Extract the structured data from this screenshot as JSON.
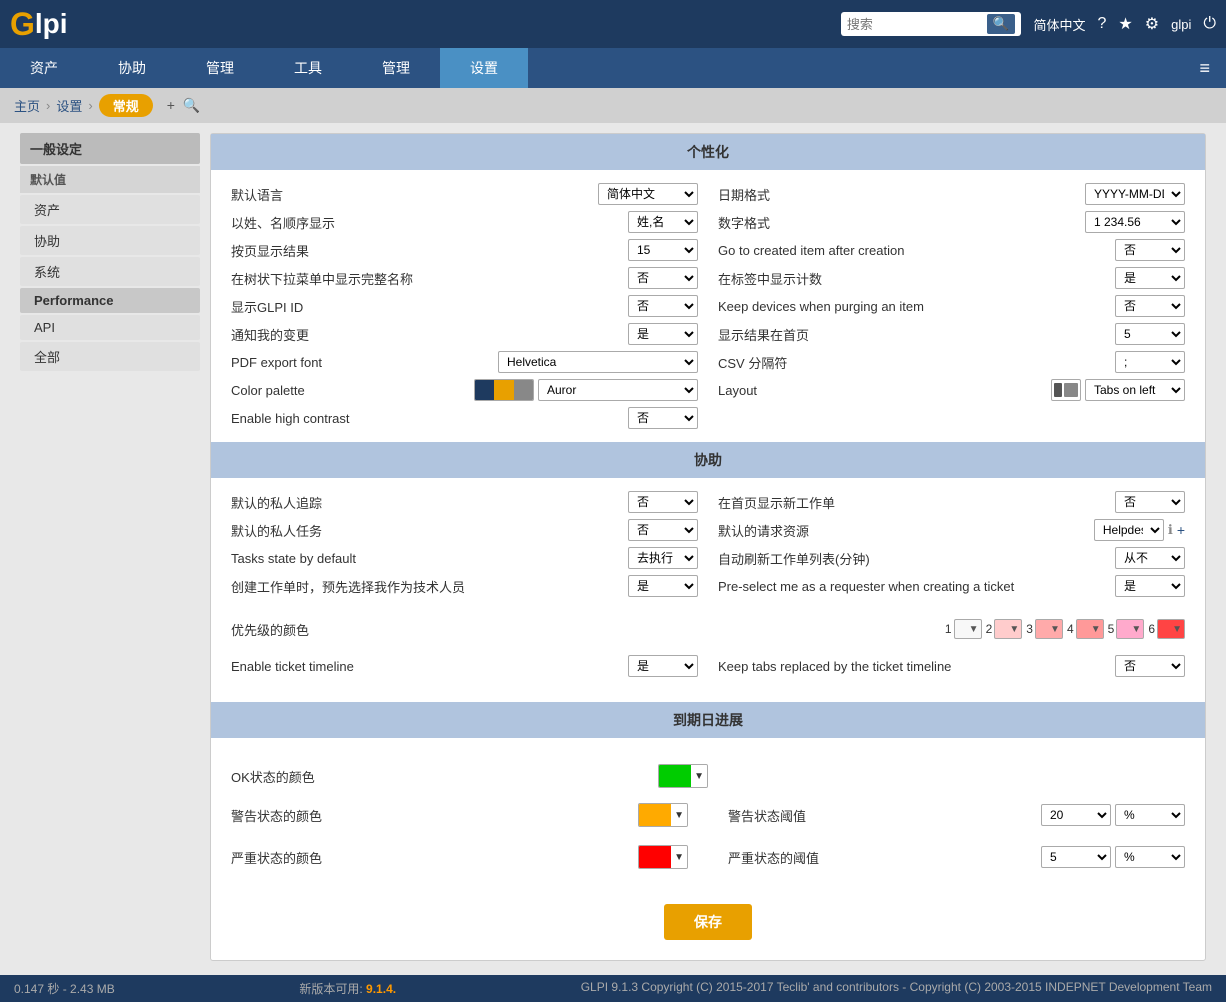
{
  "topbar": {
    "logo_g": "G",
    "logo_rest": "lpi",
    "search_placeholder": "搜索",
    "search_button_label": "🔍",
    "lang_label": "简体中文",
    "help_icon": "?",
    "star_icon": "★",
    "settings_icon": "⚙",
    "user_label": "glpi",
    "power_icon": "⏻"
  },
  "navbar": {
    "items": [
      "资产",
      "协助",
      "管理",
      "工具",
      "管理",
      "设置"
    ]
  },
  "breadcrumb": {
    "home": "主页",
    "settings": "设置",
    "current": "常规",
    "add_icon": "+",
    "search_icon": "🔍"
  },
  "sidebar": {
    "section_title": "一般设定",
    "group_title": "默认值",
    "items": [
      "资产",
      "协助",
      "系统",
      "Performance",
      "API",
      "全部"
    ]
  },
  "personalization": {
    "header": "个性化",
    "fields": {
      "left": [
        {
          "label": "默认语言",
          "value": "简体中文",
          "width": "md"
        },
        {
          "label": "以姓、名顺序显示",
          "value": "姓,名",
          "width": "sm"
        },
        {
          "label": "按页显示结果",
          "value": "15",
          "width": "sm"
        },
        {
          "label": "在树状下拉菜单中显示完整名称",
          "value": "否",
          "width": "sm"
        },
        {
          "label": "显示GLPI ID",
          "value": "否",
          "width": "sm"
        },
        {
          "label": "通知我的变更",
          "value": "是",
          "width": "sm"
        },
        {
          "label": "PDF export font",
          "value": "Helvetica",
          "width": "xl"
        },
        {
          "label": "Color palette",
          "value": "Auror",
          "width": "lg",
          "is_palette": true
        },
        {
          "label": "Enable high contrast",
          "value": "否",
          "width": "sm"
        }
      ],
      "right": [
        {
          "label": "日期格式",
          "value": "YYYY-MM-DD",
          "width": "md"
        },
        {
          "label": "数字格式",
          "value": "1 234.56",
          "width": "md"
        },
        {
          "label": "Go to created item after creation",
          "value": "否",
          "width": "sm"
        },
        {
          "label": "在标签中显示计数",
          "value": "是",
          "width": "sm"
        },
        {
          "label": "Keep devices when purging an item",
          "value": "否",
          "width": "sm"
        },
        {
          "label": "显示结果在首页",
          "value": "5",
          "width": "sm"
        },
        {
          "label": "CSV 分隔符",
          "value": ";",
          "width": "sm"
        },
        {
          "label": "Layout",
          "value": "Tabs on left",
          "width": "lg",
          "is_layout": true
        }
      ]
    }
  },
  "assistance": {
    "header": "协助",
    "fields": {
      "left": [
        {
          "label": "默认的私人追踪",
          "value": "否",
          "width": "sm"
        },
        {
          "label": "默认的私人任务",
          "value": "否",
          "width": "sm"
        },
        {
          "label": "Tasks state by default",
          "value": "去执行",
          "width": "sm"
        },
        {
          "label": "创建工作单时，预先选择我作为技术人员",
          "value": "是",
          "width": "sm"
        }
      ],
      "right": [
        {
          "label": "在首页显示新工作单",
          "value": "否",
          "width": "sm"
        },
        {
          "label": "默认的请求资源",
          "value": "Helpdesk",
          "width": "sm"
        },
        {
          "label": "自动刷新工作单列表(分钟)",
          "value": "从不",
          "width": "sm"
        },
        {
          "label": "Pre-select me as a requester when creating a ticket",
          "value": "是",
          "width": "sm"
        }
      ]
    },
    "priority_label": "优先级的颜色",
    "priorities": [
      {
        "num": "1",
        "color": "#f8f8f8"
      },
      {
        "num": "2",
        "color": "#ffcccc"
      },
      {
        "num": "3",
        "color": "#ffaaaa"
      },
      {
        "num": "4",
        "color": "#ff9999"
      },
      {
        "num": "5",
        "color": "#ffaacc"
      },
      {
        "num": "6",
        "color": "#ff4444"
      }
    ],
    "ticket_timeline_label": "Enable ticket timeline",
    "ticket_timeline_value": "是",
    "keep_tabs_label": "Keep tabs replaced by the ticket timeline",
    "keep_tabs_value": "否"
  },
  "deadline": {
    "header": "到期日进展",
    "ok_color_label": "OK状态的颜色",
    "ok_color": "#00cc00",
    "warning_color_label": "警告状态的颜色",
    "warning_color": "#ffaa00",
    "warning_threshold_label": "警告状态阈值",
    "warning_threshold_value": "20",
    "warning_threshold_unit": "%",
    "critical_color_label": "严重状态的颜色",
    "critical_color": "#ff0000",
    "critical_threshold_label": "严重状态的阈值",
    "critical_threshold_value": "5",
    "critical_threshold_unit": "%"
  },
  "save_button": "保存",
  "footer": {
    "perf": "0.147 秒 - 2.43 MB",
    "version_label": "新版本可用:",
    "version": "9.1.4.",
    "copyright": "GLPI 9.1.3 Copyright (C) 2015-2017 Teclib' and contributors - Copyright (C) 2003-2015 INDEPNET Development Team"
  }
}
